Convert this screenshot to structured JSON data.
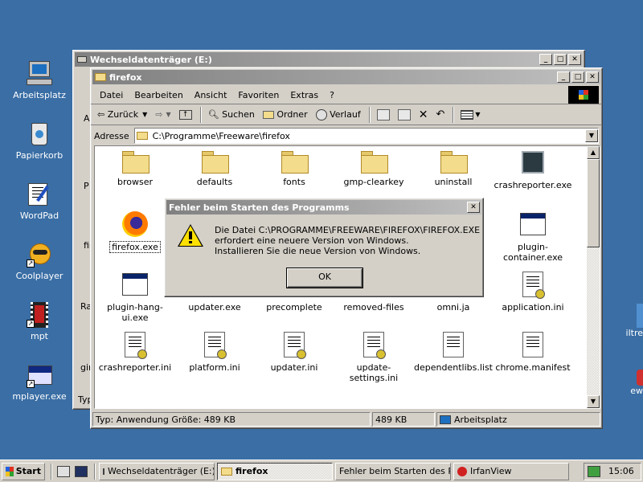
{
  "desktop": {
    "icons": [
      {
        "label": "Arbeitsplatz",
        "icon": "computer-icon"
      },
      {
        "label": "Papierkorb",
        "icon": "recycle-bin-icon"
      },
      {
        "label": "WordPad",
        "icon": "wordpad-icon"
      },
      {
        "label": "Coolplayer",
        "icon": "coolplayer-icon"
      },
      {
        "label": "mpt",
        "icon": "film-icon"
      },
      {
        "label": "mplayer.exe",
        "icon": "mplayer-icon"
      }
    ],
    "right_edge_labels": [
      "iltre",
      "ew"
    ]
  },
  "back_window": {
    "title": "Wechseldatenträger (E:)",
    "clipped_text": [
      "A",
      "P",
      "fir",
      "Ra",
      "gir",
      "Typ"
    ]
  },
  "explorer": {
    "title": "firefox",
    "menu": [
      "Datei",
      "Bearbeiten",
      "Ansicht",
      "Favoriten",
      "Extras",
      "?"
    ],
    "toolbar": {
      "back": "Zurück",
      "search": "Suchen",
      "folders": "Ordner",
      "history": "Verlauf"
    },
    "address_label": "Adresse",
    "address_value": "C:\\Programme\\Freeware\\firefox",
    "files": [
      {
        "name": "browser",
        "type": "folder"
      },
      {
        "name": "defaults",
        "type": "folder"
      },
      {
        "name": "fonts",
        "type": "folder"
      },
      {
        "name": "gmp-clearkey",
        "type": "folder"
      },
      {
        "name": "uninstall",
        "type": "folder"
      },
      {
        "name": "crashreporter.exe",
        "type": "exe"
      },
      {
        "name": "firefox.exe",
        "type": "firefox"
      },
      {
        "name": "plugin-container.exe",
        "type": "app"
      },
      {
        "name": "plugin-hang-ui.exe",
        "type": "app"
      },
      {
        "name": "updater.exe",
        "type": "none"
      },
      {
        "name": "precomplete",
        "type": "none"
      },
      {
        "name": "removed-files",
        "type": "none"
      },
      {
        "name": "omni.ja",
        "type": "none"
      },
      {
        "name": "application.ini",
        "type": "ini"
      },
      {
        "name": "crashreporter.ini",
        "type": "ini"
      },
      {
        "name": "platform.ini",
        "type": "ini"
      },
      {
        "name": "updater.ini",
        "type": "ini"
      },
      {
        "name": "update-settings.ini",
        "type": "ini"
      },
      {
        "name": "dependentlibs.list",
        "type": "doc"
      },
      {
        "name": "chrome.manifest",
        "type": "doc"
      }
    ],
    "status": {
      "left": "Typ: Anwendung Größe: 489 KB",
      "size": "489 KB",
      "zone": "Arbeitsplatz"
    }
  },
  "dialog": {
    "title": "Fehler beim Starten des Programms",
    "line1": "Die Datei C:\\PROGRAMME\\FREEWARE\\FIREFOX\\FIREFOX.EXE",
    "line2": "erfordert eine neuere Version von Windows.",
    "line3": "Installieren Sie die neue Version von Windows.",
    "ok": "OK"
  },
  "taskbar": {
    "start": "Start",
    "tasks": [
      {
        "label": "Wechseldatenträger (E:)"
      },
      {
        "label": "firefox"
      },
      {
        "label": "Fehler beim Starten des Pro..."
      },
      {
        "label": "IrfanView"
      }
    ],
    "clock": "15:06"
  },
  "colors": {
    "desktop": "#3a6ea5",
    "title_active": "#0a246a",
    "face": "#d4d0c8"
  }
}
